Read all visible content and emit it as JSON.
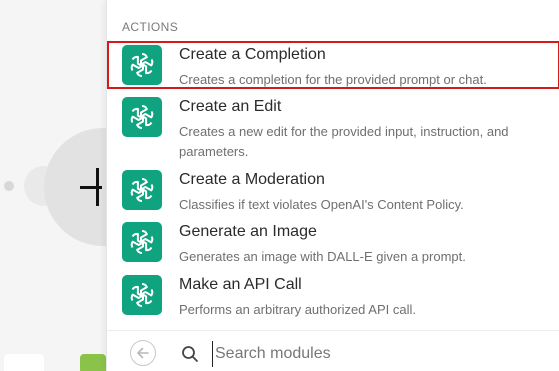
{
  "panel": {
    "section_header": "ACTIONS",
    "items": [
      {
        "title": "Create a Completion",
        "description": "Creates a completion for the provided prompt or chat.",
        "icon": "openai-icon",
        "selected": true
      },
      {
        "title": "Create an Edit",
        "description": "Creates a new edit for the provided input, instruction, and parameters.",
        "icon": "openai-icon",
        "selected": false
      },
      {
        "title": "Create a Moderation",
        "description": "Classifies if text violates OpenAI's Content Policy.",
        "icon": "openai-icon",
        "selected": false
      },
      {
        "title": "Generate an Image",
        "description": "Generates an image with DALL-E given a prompt.",
        "icon": "openai-icon",
        "selected": false
      },
      {
        "title": "Make an API Call",
        "description": "Performs an arbitrary authorized API call.",
        "icon": "openai-icon",
        "selected": false
      }
    ]
  },
  "search": {
    "placeholder": "Search modules",
    "value": "",
    "back_icon": "arrow-left-icon",
    "search_icon": "magnifier-icon"
  },
  "colors": {
    "icon_bg": "#10a37f",
    "selected_outline": "#d61a1a"
  }
}
